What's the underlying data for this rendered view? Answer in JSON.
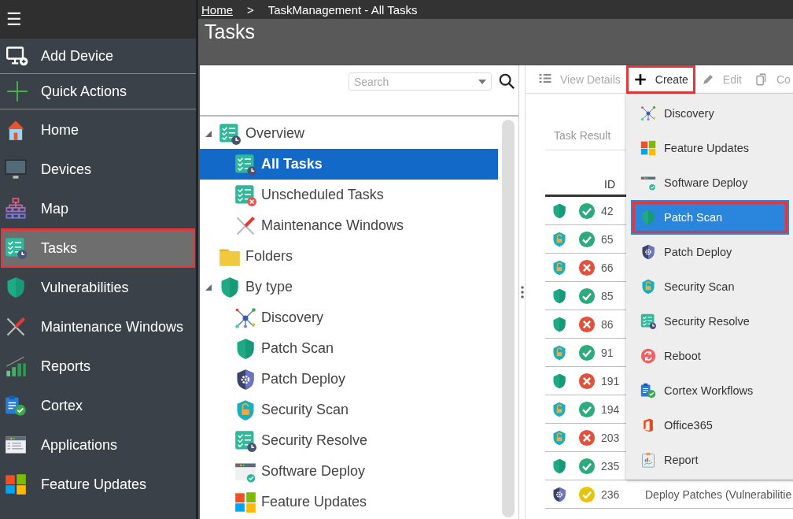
{
  "sidebar": {
    "menu_button": "☰",
    "actions": [
      {
        "label": "Add Device",
        "kind": "monitor-plus"
      },
      {
        "label": "Quick Actions",
        "kind": "plus"
      }
    ],
    "items": [
      {
        "label": "Home",
        "kind": "house",
        "selected": false,
        "highlighted": false
      },
      {
        "label": "Devices",
        "kind": "monitor",
        "selected": false,
        "highlighted": false
      },
      {
        "label": "Map",
        "kind": "hierarchy",
        "selected": false,
        "highlighted": false
      },
      {
        "label": "Tasks",
        "kind": "tasks-clock",
        "selected": true,
        "highlighted": true
      },
      {
        "label": "Vulnerabilities",
        "kind": "shield",
        "selected": false,
        "highlighted": false
      },
      {
        "label": "Maintenance Windows",
        "kind": "tools",
        "selected": false,
        "highlighted": false
      },
      {
        "label": "Reports",
        "kind": "bars",
        "selected": false,
        "highlighted": false
      },
      {
        "label": "Cortex",
        "kind": "clipboard-check",
        "selected": false,
        "highlighted": false
      },
      {
        "label": "Applications",
        "kind": "app-list",
        "selected": false,
        "highlighted": false
      },
      {
        "label": "Feature Updates",
        "kind": "windows",
        "selected": false,
        "highlighted": false
      }
    ]
  },
  "breadcrumb": [
    {
      "label": "Home",
      "kind": "link"
    },
    {
      "label": ">",
      "kind": "separator"
    },
    {
      "label": "TaskManagement - All Tasks",
      "kind": "current"
    }
  ],
  "page_title": "Tasks",
  "tree_panel": {
    "search": {
      "placeholder": "Search"
    },
    "tree": [
      {
        "label": "Overview",
        "kind": "tasks-clock",
        "expanded": true,
        "selected": false,
        "children": [
          {
            "label": "All Tasks",
            "kind": "tasks-clock",
            "selected": true
          },
          {
            "label": "Unscheduled Tasks",
            "kind": "tasks-x",
            "selected": false
          },
          {
            "label": "Maintenance Windows",
            "kind": "tools",
            "selected": false
          }
        ]
      },
      {
        "label": "Folders",
        "kind": "folder",
        "selected": false
      },
      {
        "label": "By type",
        "kind": "shield",
        "expanded": true,
        "selected": false,
        "children": [
          {
            "label": "Discovery",
            "kind": "network",
            "selected": false
          },
          {
            "label": "Patch Scan",
            "kind": "shield",
            "selected": false
          },
          {
            "label": "Patch Deploy",
            "kind": "shield-gear",
            "selected": false
          },
          {
            "label": "Security Scan",
            "kind": "shield-lock",
            "selected": false
          },
          {
            "label": "Security Resolve",
            "kind": "tasks-clock",
            "selected": false
          },
          {
            "label": "Software Deploy",
            "kind": "app-check",
            "selected": false
          },
          {
            "label": "Feature Updates",
            "kind": "windows",
            "selected": false
          }
        ]
      }
    ]
  },
  "toolbar": [
    {
      "label": "View Details",
      "kind": "list",
      "disabled": true,
      "highlighted": false
    },
    {
      "label": "Create",
      "kind": "plus-black",
      "disabled": false,
      "highlighted": true
    },
    {
      "label": "Edit",
      "kind": "pencil",
      "disabled": true,
      "highlighted": false
    },
    {
      "label": "Co",
      "kind": "copy",
      "disabled": true,
      "highlighted": false
    }
  ],
  "tab": "Task Result",
  "table": {
    "columns": [
      "ID"
    ],
    "rows": [
      {
        "kind": "shield",
        "failed": false,
        "color": "#2bab7e",
        "id": "42"
      },
      {
        "kind": "shield-lock",
        "failed": false,
        "color": "#2bab7e",
        "id": "65"
      },
      {
        "kind": "shield-lock",
        "failed": true,
        "color": "#e0513e",
        "id": "66"
      },
      {
        "kind": "shield",
        "failed": false,
        "color": "#2bab7e",
        "id": "85"
      },
      {
        "kind": "shield",
        "failed": true,
        "color": "#e0513e",
        "id": "86"
      },
      {
        "kind": "shield-lock",
        "failed": false,
        "color": "#2bab7e",
        "id": "91"
      },
      {
        "kind": "shield",
        "failed": true,
        "color": "#e0513e",
        "id": "191"
      },
      {
        "kind": "shield-lock",
        "failed": false,
        "color": "#2bab7e",
        "id": "194"
      },
      {
        "kind": "shield-lock",
        "failed": true,
        "color": "#e0513e",
        "id": "203"
      },
      {
        "kind": "shield",
        "failed": false,
        "color": "#2bab7e",
        "id": "235"
      },
      {
        "kind": "shield-gear",
        "failed": false,
        "color": "#e8c30a",
        "id": "236",
        "name": "Deploy Patches (Vulnerabilitie"
      }
    ]
  },
  "create_menu": [
    {
      "label": "Discovery",
      "kind": "network",
      "selected": false,
      "highlighted": false
    },
    {
      "label": "Feature Updates",
      "kind": "windows",
      "selected": false,
      "highlighted": false
    },
    {
      "label": "Software Deploy",
      "kind": "app-check",
      "selected": false,
      "highlighted": false
    },
    {
      "label": "Patch Scan",
      "kind": "shield",
      "selected": true,
      "highlighted": true
    },
    {
      "label": "Patch Deploy",
      "kind": "shield-gear",
      "selected": false,
      "highlighted": false
    },
    {
      "label": "Security Scan",
      "kind": "shield-lock",
      "selected": false,
      "highlighted": false
    },
    {
      "label": "Security Resolve",
      "kind": "tasks-clock",
      "selected": false,
      "highlighted": false
    },
    {
      "label": "Reboot",
      "kind": "reboot",
      "selected": false,
      "highlighted": false
    },
    {
      "label": "Cortex Workflows",
      "kind": "clipboard-check",
      "selected": false,
      "highlighted": false
    },
    {
      "label": "Office365",
      "kind": "office",
      "selected": false,
      "highlighted": false
    },
    {
      "label": "Report",
      "kind": "report",
      "selected": false,
      "highlighted": false
    }
  ]
}
